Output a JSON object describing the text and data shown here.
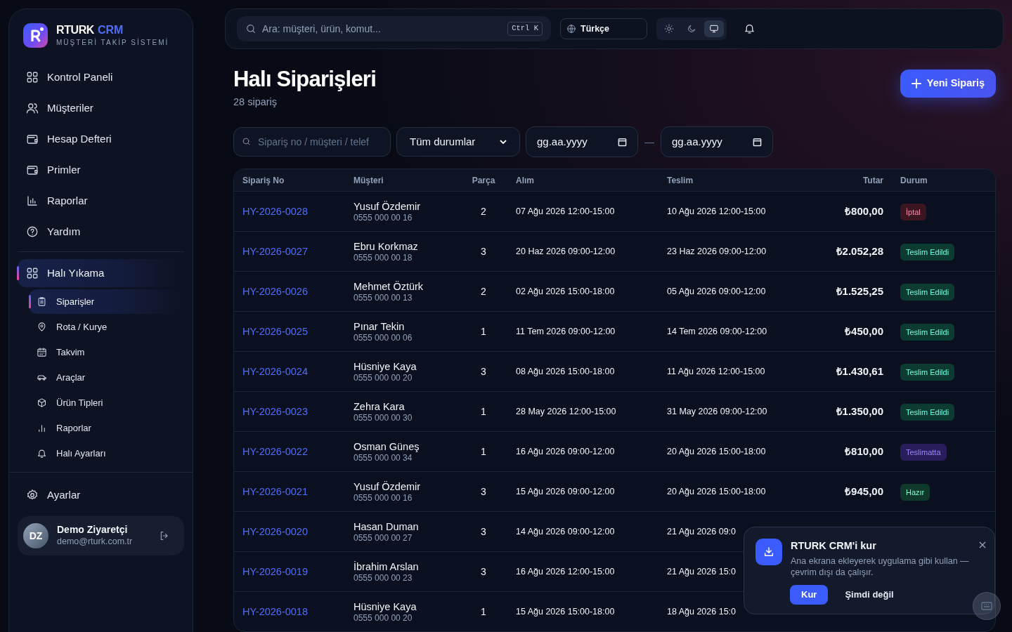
{
  "brand": {
    "name": "RTURK",
    "accent": "CRM",
    "tagline": "MÜŞTERİ TAKİP SİSTEMİ"
  },
  "sidebar": {
    "items": [
      {
        "label": "Kontrol Paneli",
        "selected": false
      },
      {
        "label": "Müşteriler",
        "selected": false
      },
      {
        "label": "Hesap Defteri",
        "selected": false
      },
      {
        "label": "Primler",
        "selected": false
      },
      {
        "label": "Raporlar",
        "selected": false
      },
      {
        "label": "Yardım",
        "selected": false
      },
      {
        "label": "Halı Yıkama",
        "selected": true,
        "children": [
          {
            "label": "Siparişler",
            "selected": true
          },
          {
            "label": "Rota / Kurye",
            "selected": false
          },
          {
            "label": "Takvim",
            "selected": false
          },
          {
            "label": "Araçlar",
            "selected": false
          },
          {
            "label": "Ürün Tipleri",
            "selected": false
          },
          {
            "label": "Raporlar",
            "selected": false
          },
          {
            "label": "Halı Ayarları",
            "selected": false
          }
        ]
      }
    ],
    "settings": "Ayarlar",
    "user": {
      "initials": "DZ",
      "name": "Demo Ziyaretçi",
      "email": "demo@rturk.com.tr"
    }
  },
  "topbar": {
    "search_placeholder": "Ara: müşteri, ürün, komut...",
    "shortcut": "Ctrl K",
    "language": "Türkçe",
    "theme_options": [
      {
        "selected": false
      },
      {
        "selected": false
      },
      {
        "selected": true
      }
    ]
  },
  "page": {
    "title": "Halı Siparişleri",
    "subtitle": "28 sipariş",
    "new_button": "Yeni Sipariş"
  },
  "filters": {
    "search_placeholder": "Sipariş no / müşteri / telef",
    "status": "Tüm durumlar",
    "date_from": "gg.aa.yyyy",
    "separator": "—",
    "date_to": "gg.aa.yyyy"
  },
  "table": {
    "columns": [
      "Sipariş No",
      "Müşteri",
      "Parça",
      "Alım",
      "Teslim",
      "Tutar",
      "Durum"
    ],
    "rows": [
      {
        "order": "HY-2026-0028",
        "customer": "Yusuf Özdemir",
        "phone": "0555 000 00 16",
        "pieces": "2",
        "pickup": "07 Ağu 2026 12:00-15:00",
        "delivery": "10 Ağu 2026 12:00-15:00",
        "amount": "₺800,00",
        "status": {
          "label": "İptal",
          "color": "#3b1520"
        }
      },
      {
        "order": "HY-2026-0027",
        "customer": "Ebru Korkmaz",
        "phone": "0555 000 00 18",
        "pieces": "3",
        "pickup": "20 Haz 2026 09:00-12:00",
        "delivery": "23 Haz 2026 09:00-12:00",
        "amount": "₺2.052,28",
        "status": {
          "label": "Teslim Edildi",
          "color": "#0b3b31"
        }
      },
      {
        "order": "HY-2026-0026",
        "customer": "Mehmet Öztürk",
        "phone": "0555 000 00 13",
        "pieces": "2",
        "pickup": "02 Ağu 2026 15:00-18:00",
        "delivery": "05 Ağu 2026 09:00-12:00",
        "amount": "₺1.525,25",
        "status": {
          "label": "Teslim Edildi",
          "color": "#0b3b31"
        }
      },
      {
        "order": "HY-2026-0025",
        "customer": "Pınar Tekin",
        "phone": "0555 000 00 06",
        "pieces": "1",
        "pickup": "11 Tem 2026 09:00-12:00",
        "delivery": "14 Tem 2026 09:00-12:00",
        "amount": "₺450,00",
        "status": {
          "label": "Teslim Edildi",
          "color": "#0b3b31"
        }
      },
      {
        "order": "HY-2026-0024",
        "customer": "Hüsniye Kaya",
        "phone": "0555 000 00 20",
        "pieces": "3",
        "pickup": "08 Ağu 2026 15:00-18:00",
        "delivery": "11 Ağu 2026 12:00-15:00",
        "amount": "₺1.430,61",
        "status": {
          "label": "Teslim Edildi",
          "color": "#0b3b31"
        }
      },
      {
        "order": "HY-2026-0023",
        "customer": "Zehra Kara",
        "phone": "0555 000 00 30",
        "pieces": "1",
        "pickup": "28 May 2026 12:00-15:00",
        "delivery": "31 May 2026 09:00-12:00",
        "amount": "₺1.350,00",
        "status": {
          "label": "Teslim Edildi",
          "color": "#0b3b31"
        }
      },
      {
        "order": "HY-2026-0022",
        "customer": "Osman Güneş",
        "phone": "0555 000 00 34",
        "pieces": "1",
        "pickup": "16 Ağu 2026 09:00-12:00",
        "delivery": "20 Ağu 2026 15:00-18:00",
        "amount": "₺810,00",
        "status": {
          "label": "Teslimatta",
          "color": "#2a1d5c"
        }
      },
      {
        "order": "HY-2026-0021",
        "customer": "Yusuf Özdemir",
        "phone": "0555 000 00 16",
        "pieces": "3",
        "pickup": "15 Ağu 2026 09:00-12:00",
        "delivery": "20 Ağu 2026 15:00-18:00",
        "amount": "₺945,00",
        "status": {
          "label": "Hazır",
          "color": "#0f3a2b"
        }
      },
      {
        "order": "HY-2026-0020",
        "customer": "Hasan Duman",
        "phone": "0555 000 00 27",
        "pieces": "3",
        "pickup": "14 Ağu 2026 09:00-12:00",
        "delivery": "21 Ağu 2026 09:0"
      },
      {
        "order": "HY-2026-0019",
        "customer": "İbrahim Arslan",
        "phone": "0555 000 00 23",
        "pieces": "3",
        "pickup": "16 Ağu 2026 12:00-15:00",
        "delivery": "21 Ağu 2026 15:0"
      },
      {
        "order": "HY-2026-0018",
        "customer": "Hüsniye Kaya",
        "phone": "0555 000 00 20",
        "pieces": "1",
        "pickup": "15 Ağu 2026 15:00-18:00",
        "delivery": "18 Ağu 2026 15:0"
      }
    ]
  },
  "install_prompt": {
    "title": "RTURK CRM'i kur",
    "text": "Ana ekrana ekleyerek uygulama gibi kullan — çevrim dışı da çalışır.",
    "install": "Kur",
    "dismiss": "Şimdi değil"
  }
}
